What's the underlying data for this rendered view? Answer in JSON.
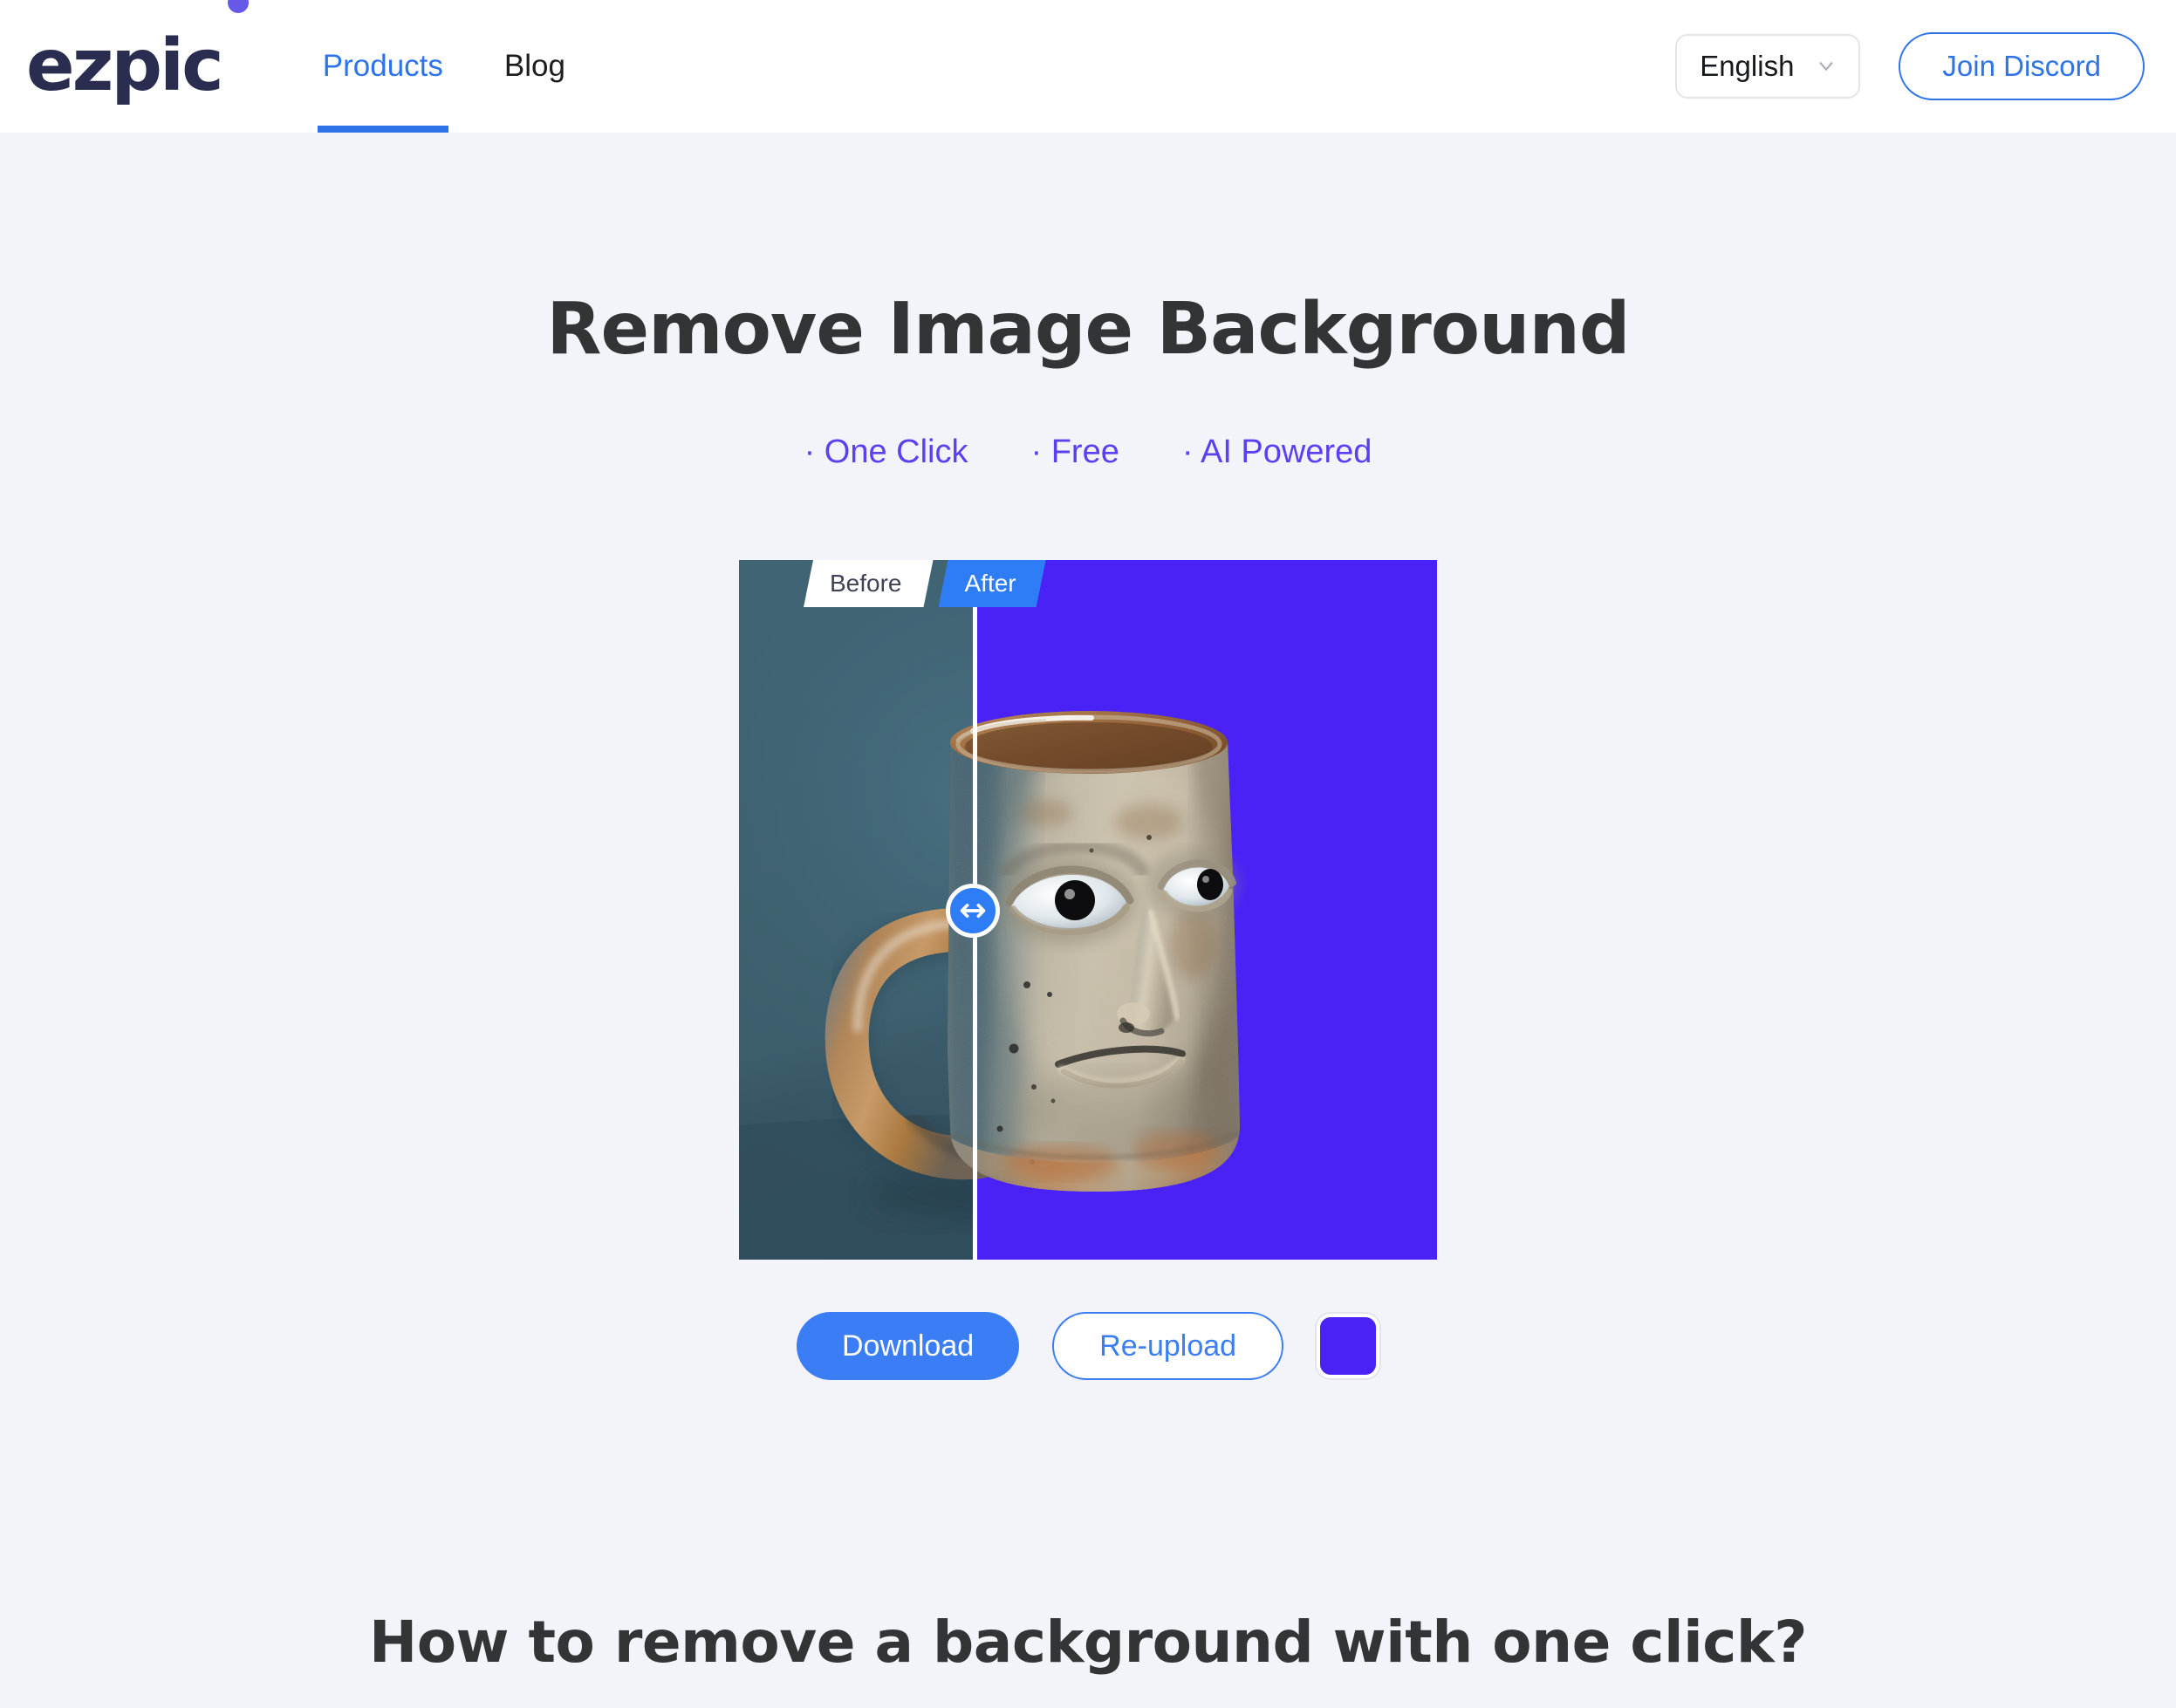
{
  "header": {
    "logo_text": "ezpic",
    "logo_dot_color": "#6659e8",
    "logo_color": "#2b2d50",
    "nav": [
      {
        "label": "Products",
        "active": true
      },
      {
        "label": "Blog",
        "active": false
      }
    ],
    "language": {
      "value": "English",
      "icon": "chevron-down-icon"
    },
    "discord_button": "Join Discord",
    "accent_color": "#2e74e8"
  },
  "hero": {
    "title": "Remove Image Background",
    "features": [
      "· One Click",
      "· Free",
      "· AI Powered"
    ],
    "features_color": "#5b3ff0"
  },
  "compare": {
    "tab_before": "Before",
    "tab_after": "After",
    "handle_icon": "arrows-left-right-icon",
    "before_background_color": "#3d5f6e",
    "after_background_color": "#4a22f5",
    "subject": "ceramic face mug",
    "divider_position_percent": 33.5
  },
  "actions": {
    "download_label": "Download",
    "reupload_label": "Re-upload",
    "color_swatch_value": "#4a22f5",
    "download_color": "#3b7df5",
    "reupload_color": "#3b7df5"
  },
  "section": {
    "title": "How to remove a background with one click?"
  },
  "page": {
    "background_color": "#f2f4f9"
  }
}
